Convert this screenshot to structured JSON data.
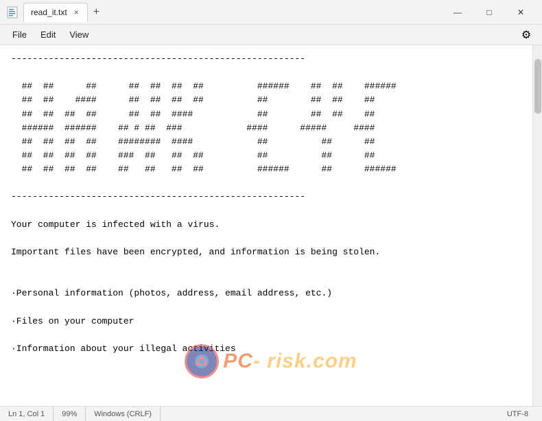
{
  "titlebar": {
    "icon": "notepad",
    "tab_label": "read_it.txt",
    "tab_close": "×",
    "tab_new": "+",
    "btn_minimize": "—",
    "btn_maximize": "□",
    "btn_close": "✕"
  },
  "menubar": {
    "items": [
      "File",
      "Edit",
      "View"
    ],
    "gear_icon": "⚙"
  },
  "editor": {
    "content": "-------------------------------------------------------\n\n  ##  ##      ##      ##  ##  ##  ##          ######    ##  ##    ######\n  ##  ##    ####      ##  ##  ##  ##          ##        ##  ##    ##\n  ##  ##  ##  ##      ##  ##  ####            ##        ##  ##    ##\n  ######  ######    ## # ##  ###            ####      #####     ####\n  ##  ##  ##  ##    ########  ####            ##          ##      ##\n  ##  ##  ##  ##    ###  ##   ##  ##          ##          ##      ##\n  ##  ##  ##  ##    ##   ##   ##  ##          ######      ##      ######\n\n-------------------------------------------------------\n\nYour computer is infected with a virus.\n\nImportant files have been encrypted, and information is being stolen.\n\n\n·Personal information (photos, address, email address, etc.)\n\n·Files on your computer\n\n·Information about your illegal activities"
  },
  "statusbar": {
    "position": "Ln 1, Col 1",
    "zoom": "99%",
    "line_ending": "Windows (CRLF)",
    "encoding": "UTF-8"
  },
  "watermark": {
    "circle_text": "PC",
    "brand_text": "- risk.com"
  }
}
